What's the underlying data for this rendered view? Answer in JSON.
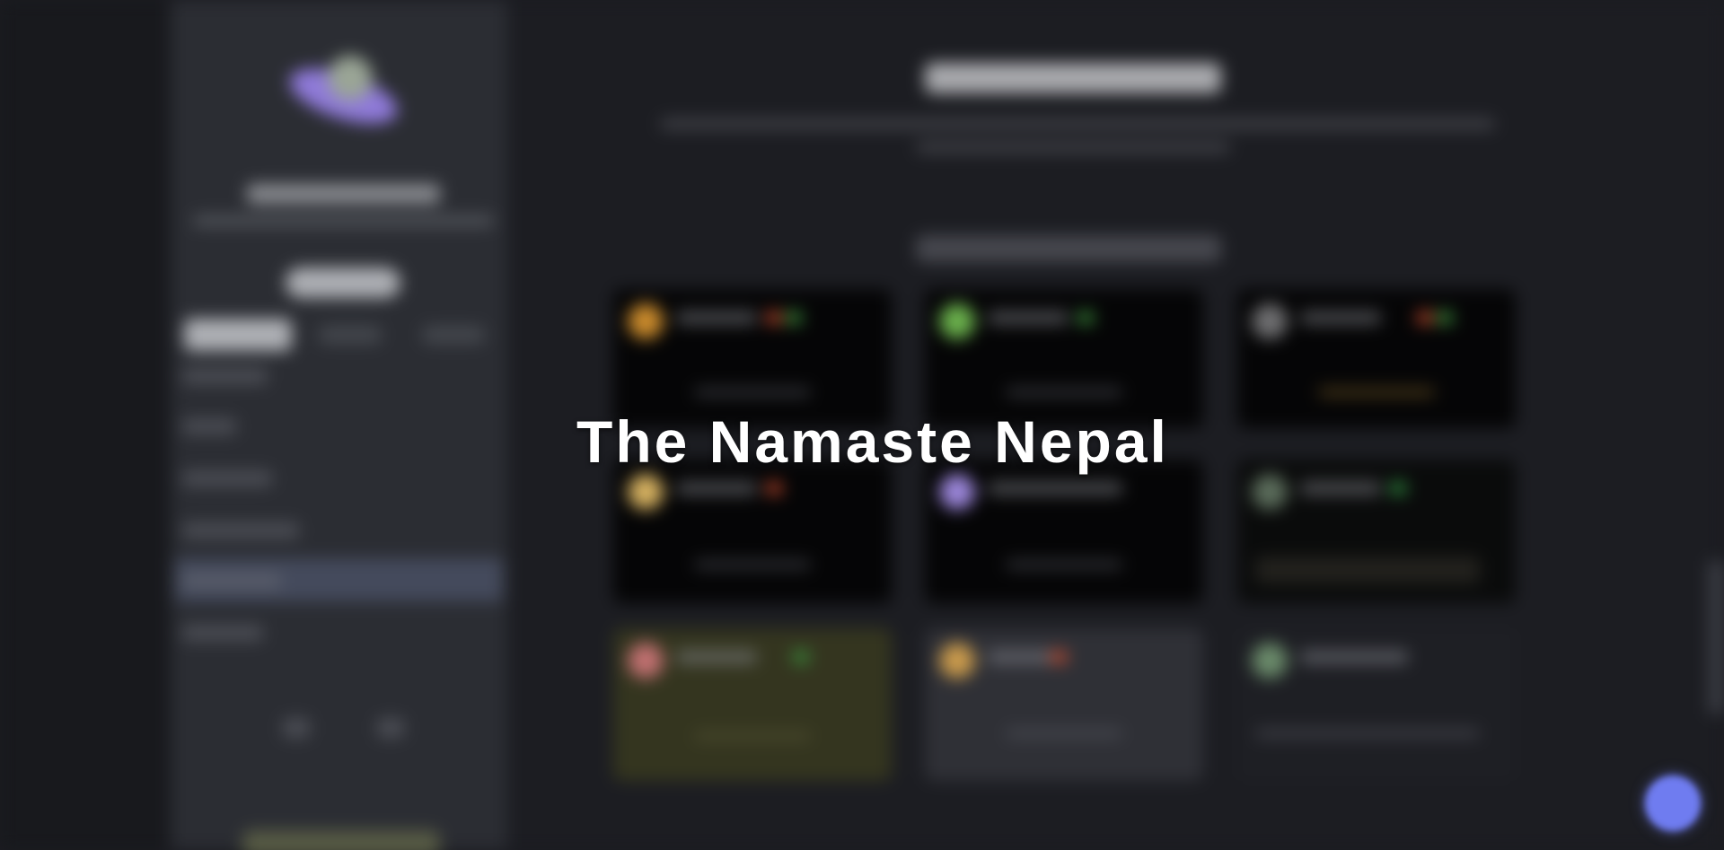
{
  "overlay": {
    "title": "The Namaste Nepal"
  },
  "colors": {
    "page_background": "#1b1c21",
    "sidebar_background": "#2b2d33",
    "selected_item": "#444a5c",
    "card_background": "#050506",
    "chat_button": "#6f7cf0",
    "logo_accent": "#8f7ad9",
    "overlay_text": "#ffffff"
  },
  "icons": {
    "logo": "planet-logo-icon",
    "chat": "chat-bubble-icon"
  }
}
